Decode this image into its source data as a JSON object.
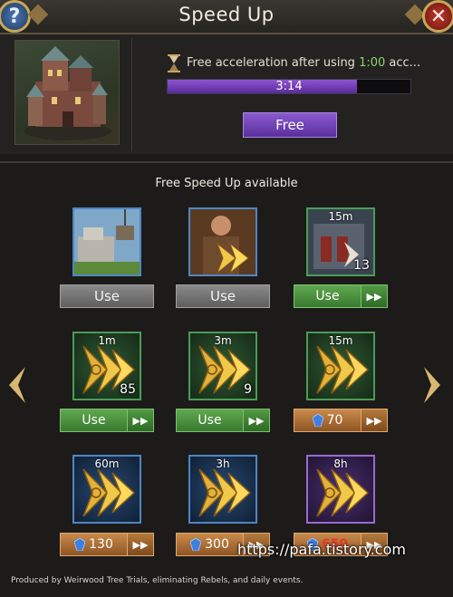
{
  "header": {
    "title": "Speed Up",
    "help_label": "?",
    "close_label": "✕"
  },
  "timer": {
    "prefix": "Free acceleration after using ",
    "highlight": "1:00",
    "suffix": " acc...",
    "progress_text": "3:14",
    "progress_fraction": 0.78,
    "free_label": "Free",
    "icon": "hourglass-icon"
  },
  "section_title": "Free Speed Up available",
  "items": [
    {
      "duration": "",
      "count": "",
      "frame": "blue",
      "button": {
        "style": "gray",
        "label": "Use"
      }
    },
    {
      "duration": "",
      "count": "",
      "frame": "blue",
      "button": {
        "style": "gray",
        "label": "Use"
      }
    },
    {
      "duration": "15m",
      "count": "13",
      "frame": "green",
      "button": {
        "style": "green",
        "label": "Use"
      }
    },
    {
      "duration": "1m",
      "count": "85",
      "frame": "green",
      "button": {
        "style": "green",
        "label": "Use"
      }
    },
    {
      "duration": "3m",
      "count": "9",
      "frame": "green",
      "button": {
        "style": "green",
        "label": "Use"
      }
    },
    {
      "duration": "15m",
      "count": "",
      "frame": "green",
      "button": {
        "style": "orange",
        "label": "70"
      }
    },
    {
      "duration": "60m",
      "count": "",
      "frame": "blue",
      "button": {
        "style": "orange",
        "label": "130"
      }
    },
    {
      "duration": "3h",
      "count": "",
      "frame": "blue",
      "button": {
        "style": "orange",
        "label": "300"
      }
    },
    {
      "duration": "8h",
      "count": "",
      "frame": "purple",
      "button": {
        "style": "orange",
        "label": "650"
      }
    }
  ],
  "footer": "Produced by Weirwood Tree Trials, eliminating Rebels, and daily events.",
  "watermark": "https://pafa.tistory.com",
  "colors": {
    "accent_purple": "#6f3fb8",
    "green_button": "#4a8c3c",
    "orange_button": "#a66a32",
    "gold": "#c9a65a"
  }
}
